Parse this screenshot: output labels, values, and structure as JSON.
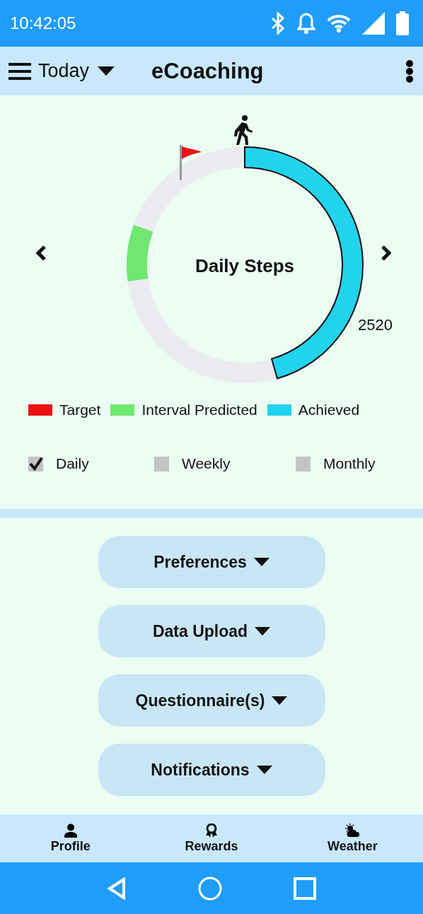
{
  "status_bar": {
    "time": "10:42:05"
  },
  "app_bar": {
    "period": "Today",
    "title": "eCoaching"
  },
  "gauge": {
    "title": "Daily Steps",
    "reading": "2520"
  },
  "legend": [
    {
      "label": "Target",
      "color": "#ee1111"
    },
    {
      "label": "Interval Predicted",
      "color": "#6fe86f"
    },
    {
      "label": "Achieved",
      "color": "#22d3ee"
    }
  ],
  "periods": [
    {
      "label": "Daily",
      "checked": true
    },
    {
      "label": "Weekly",
      "checked": false
    },
    {
      "label": "Monthly",
      "checked": false
    }
  ],
  "menu_buttons": [
    "Preferences",
    "Data Upload",
    "Questionnaire(s)",
    "Notifications"
  ],
  "bottom_nav": [
    {
      "kind": "profile",
      "label": "Profile"
    },
    {
      "kind": "rewards",
      "label": "Rewards"
    },
    {
      "kind": "weather",
      "label": "Weather"
    }
  ]
}
